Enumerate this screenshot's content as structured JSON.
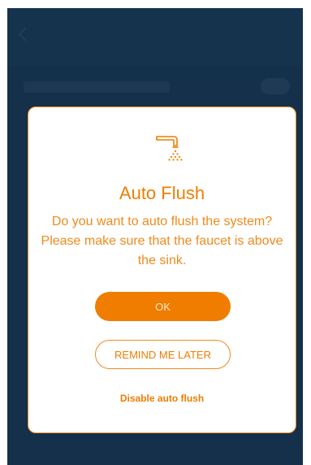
{
  "dialog": {
    "icon": "faucet-icon",
    "title": "Auto Flush",
    "message": "Do you want to auto flush the system? Please make sure that the faucet is above the sink.",
    "ok_label": "OK",
    "remind_label": "REMIND ME LATER",
    "disable_label": "Disable auto flush"
  },
  "colors": {
    "accent": "#ef7d00",
    "background": "#14304a",
    "dialog_bg": "#ffffff"
  }
}
